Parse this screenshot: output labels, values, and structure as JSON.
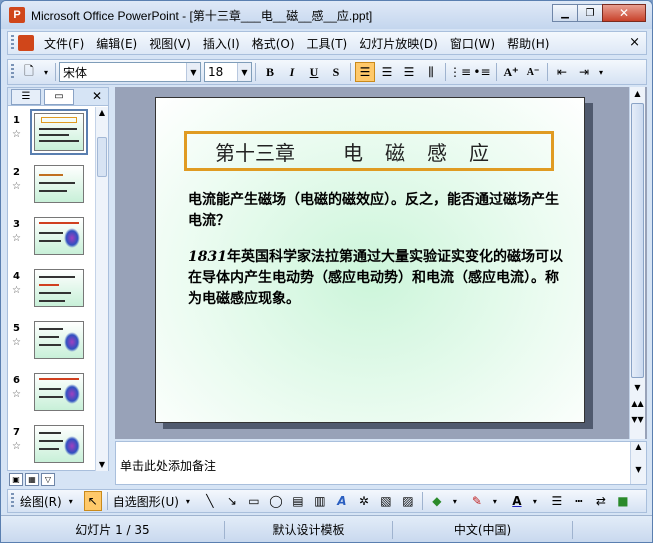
{
  "window": {
    "title": "Microsoft Office PowerPoint - [第十三章___电__磁__感__应.ppt]",
    "app_icon": "P"
  },
  "menu": {
    "items": [
      "文件(F)",
      "编辑(E)",
      "视图(V)",
      "插入(I)",
      "格式(O)",
      "工具(T)",
      "幻灯片放映(D)",
      "窗口(W)",
      "帮助(H)"
    ],
    "close": "×"
  },
  "toolbar": {
    "font_name": "宋体",
    "font_size": "18",
    "bold": "B",
    "italic": "I",
    "underline": "U",
    "shadow": "S",
    "increase_font": "A⁺",
    "decrease_font": "A⁻"
  },
  "thumbnails": [
    {
      "number": "1",
      "selected": true
    },
    {
      "number": "2",
      "selected": false
    },
    {
      "number": "3",
      "selected": false
    },
    {
      "number": "4",
      "selected": false
    },
    {
      "number": "5",
      "selected": false
    },
    {
      "number": "6",
      "selected": false
    },
    {
      "number": "7",
      "selected": false
    }
  ],
  "slide": {
    "title_part1": "第十三章",
    "title_part2": "电磁感应",
    "paragraph1": "电流能产生磁场（电磁的磁效应）。反之，能否通过磁场产生电流？",
    "paragraph2_year": "1831",
    "paragraph2_rest": "年英国科学家法拉第通过大量实验证实变化的磁场可以在导体内产生电动势（感应电动势）和电流（感应电流）。称为电磁感应现象。"
  },
  "notes": {
    "placeholder": "单击此处添加备注"
  },
  "drawbar": {
    "draw_menu": "绘图(R)",
    "autoshapes_menu": "自选图形(U)"
  },
  "status": {
    "slide_info": "幻灯片 1 / 35",
    "design": "默认设计模板",
    "language": "中文(中国)"
  }
}
